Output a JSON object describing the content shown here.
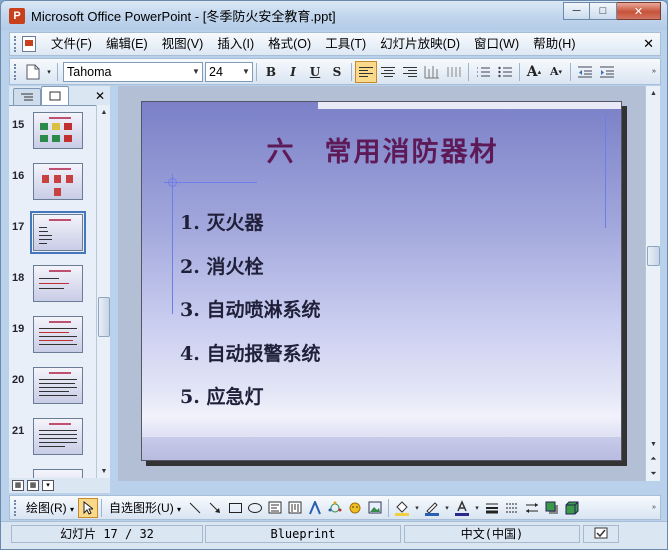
{
  "window": {
    "title": "Microsoft Office PowerPoint - [冬季防火安全教育.ppt]",
    "minimize": "─",
    "maximize": "□",
    "close": "✕"
  },
  "menu": {
    "items": [
      "文件(F)",
      "编辑(E)",
      "视图(V)",
      "插入(I)",
      "格式(O)",
      "工具(T)",
      "幻灯片放映(D)",
      "窗口(W)",
      "帮助(H)"
    ],
    "close_glyph": "✕"
  },
  "toolbar": {
    "font_name": "Tahoma",
    "font_size": "24",
    "bold": "B",
    "italic": "I",
    "underline": "U",
    "shadow": "S",
    "grow_font": "A",
    "shrink_font": "A"
  },
  "slide_panel": {
    "tabs": [
      "outline-tab",
      "slides-tab"
    ],
    "close_glyph": "✕",
    "slides": [
      {
        "number": "15",
        "selected": false
      },
      {
        "number": "16",
        "selected": false
      },
      {
        "number": "17",
        "selected": true
      },
      {
        "number": "18",
        "selected": false
      },
      {
        "number": "19",
        "selected": false
      },
      {
        "number": "20",
        "selected": false
      },
      {
        "number": "21",
        "selected": false
      }
    ]
  },
  "slide": {
    "title": "六　常用消防器材",
    "bullets": [
      "1. 灭火器",
      "2. 消火栓",
      "3. 自动喷淋系统",
      "4. 自动报警系统",
      "5. 应急灯"
    ]
  },
  "drawing_toolbar": {
    "draw_label": "绘图(R)",
    "autoshapes_label": "自选图形(U)"
  },
  "status": {
    "slide_position": "幻灯片 17 / 32",
    "design": "Blueprint",
    "language": "中文(中国)"
  },
  "colors": {
    "title": "#5e1a56",
    "accent": "#fbd98a"
  }
}
